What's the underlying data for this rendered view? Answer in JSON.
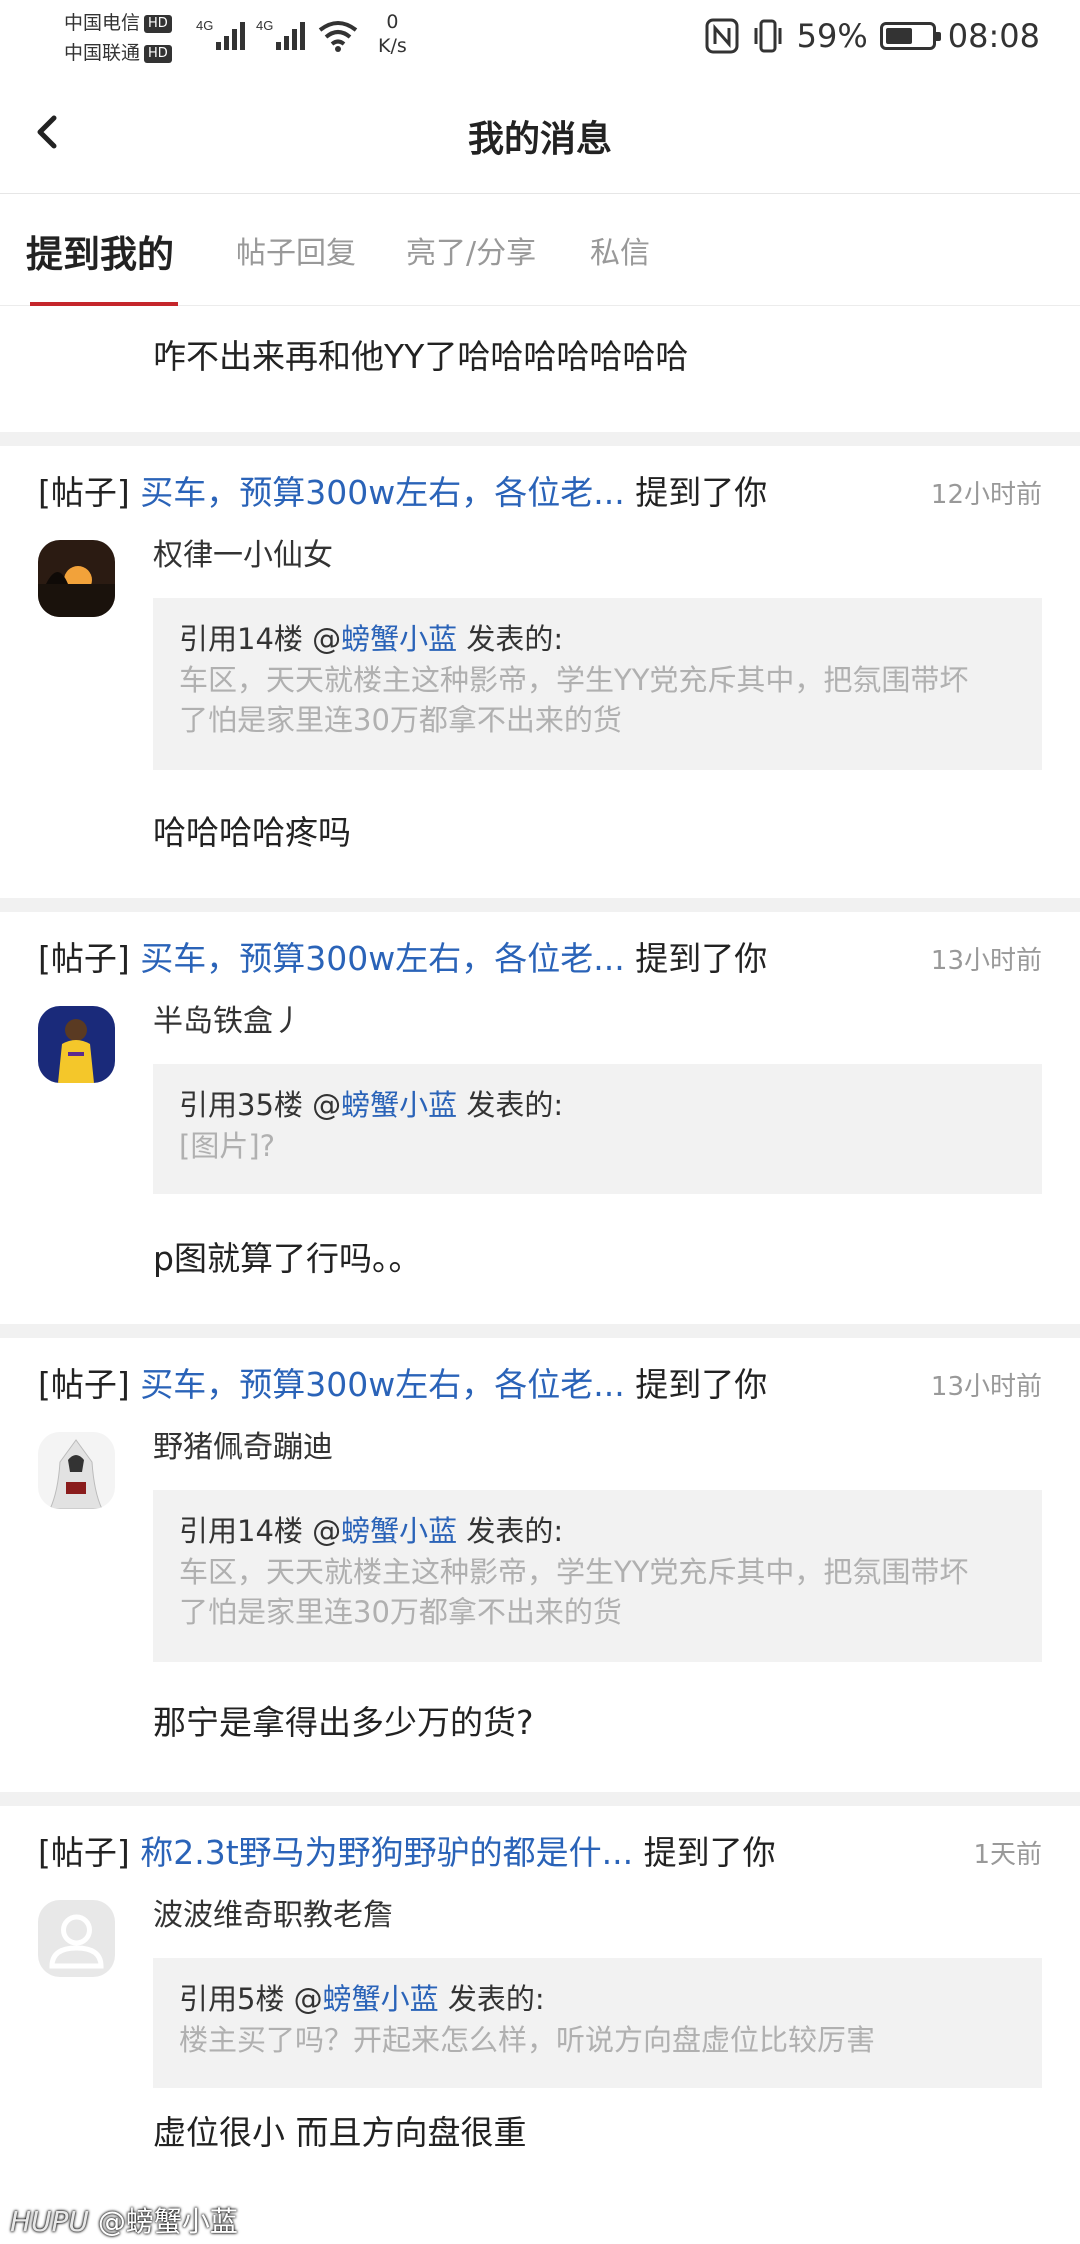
{
  "status_bar": {
    "carrier1": "中国电信",
    "carrier2": "中国联通",
    "hd": "HD",
    "net1": "4G",
    "net2": "4G",
    "speed_value": "0",
    "speed_unit": "K/s",
    "battery_percent": "59%",
    "battery_level": 0.59,
    "time": "08:08"
  },
  "nav": {
    "title": "我的消息"
  },
  "tabs": [
    {
      "label": "提到我的",
      "active": true
    },
    {
      "label": "帖子回复",
      "active": false
    },
    {
      "label": "亮了/分享",
      "active": false
    },
    {
      "label": "私信",
      "active": false
    }
  ],
  "partial_item": {
    "text": "咋不出来再和他YY了哈哈哈哈哈哈哈"
  },
  "messages": [
    {
      "tag": "[帖子]",
      "post_title": "买车，预算300w左右，各位老...",
      "mention_text": "提到了你",
      "time": "12小时前",
      "username": "权律一小仙女",
      "quote_prefix": "引用14楼 @",
      "quote_user": "螃蟹小蓝",
      "quote_suffix": " 发表的:",
      "quote_line1": "车区，天天就楼主这种影帝，学生YY党充斥其中，把氛围带坏",
      "quote_line2": "了怕是家里连30万都拿不出来的货",
      "reply": "哈哈哈哈疼吗"
    },
    {
      "tag": "[帖子]",
      "post_title": "买车，预算300w左右，各位老...",
      "mention_text": "提到了你",
      "time": "13小时前",
      "username": "半岛铁盒丿",
      "quote_prefix": "引用35楼 @",
      "quote_user": "螃蟹小蓝",
      "quote_suffix": " 发表的:",
      "quote_line1": "[图片]?",
      "reply": "p图就算了行吗。。"
    },
    {
      "tag": "[帖子]",
      "post_title": "买车，预算300w左右，各位老...",
      "mention_text": "提到了你",
      "time": "13小时前",
      "username": "野猪佩奇蹦迪",
      "quote_prefix": "引用14楼 @",
      "quote_user": "螃蟹小蓝",
      "quote_suffix": " 发表的:",
      "quote_line1": "车区，天天就楼主这种影帝，学生YY党充斥其中，把氛围带坏",
      "quote_line2": "了怕是家里连30万都拿不出来的货",
      "reply": "那宁是拿得出多少万的货?"
    },
    {
      "tag": "[帖子]",
      "post_title": "称2.3t野马为野狗野驴的都是什...",
      "mention_text": "提到了你",
      "time": "1天前",
      "username": "波波维奇职教老詹",
      "quote_prefix": "引用5楼 @",
      "quote_user": "螃蟹小蓝",
      "quote_suffix": " 发表的:",
      "quote_line1": "楼主买了吗？开起来怎么样，听说方向盘虚位比较厉害",
      "reply": "虚位很小 而且方向盘很重"
    }
  ],
  "watermark": {
    "brand": "HUPU",
    "user": "@螃蟹小蓝"
  }
}
